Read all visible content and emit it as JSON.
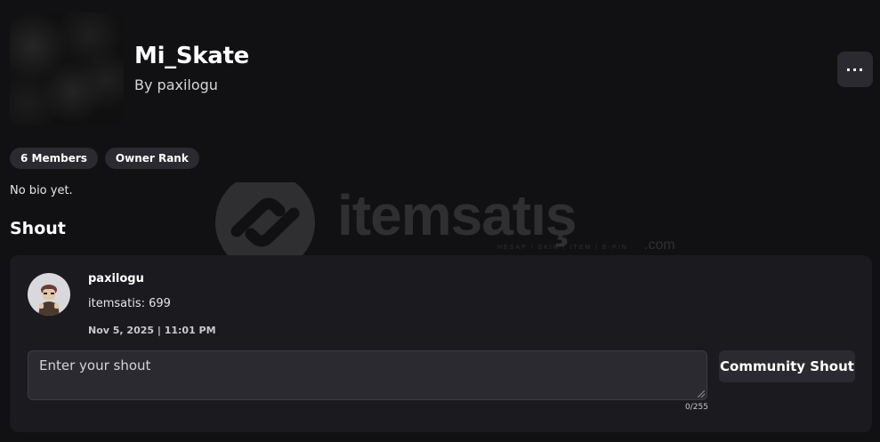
{
  "group": {
    "name": "Mi_Skate",
    "owner_prefix": "By ",
    "owner_name": "paxilogu",
    "more_icon": "ellipsis-icon"
  },
  "pills": [
    {
      "label": "6 Members"
    },
    {
      "label": "Owner Rank"
    }
  ],
  "bio": "No bio yet.",
  "shout_section": {
    "title": "Shout",
    "post": {
      "author": "paxilogu",
      "body": "itemsatis: 699",
      "timestamp": "Nov 5, 2025 | 11:01 PM"
    },
    "input": {
      "placeholder": "Enter your shout",
      "value": "",
      "char_count": "0/255"
    },
    "submit_label": "Community Shout"
  },
  "watermark": {
    "brand": "itemsatış",
    "tagline": "HESAP / SKIN / ITEM / E-PIN",
    "suffix": ".com"
  },
  "colors": {
    "background": "#111114",
    "card": "#1b1b1f",
    "pill": "#2a2a30",
    "text": "#ffffff"
  }
}
